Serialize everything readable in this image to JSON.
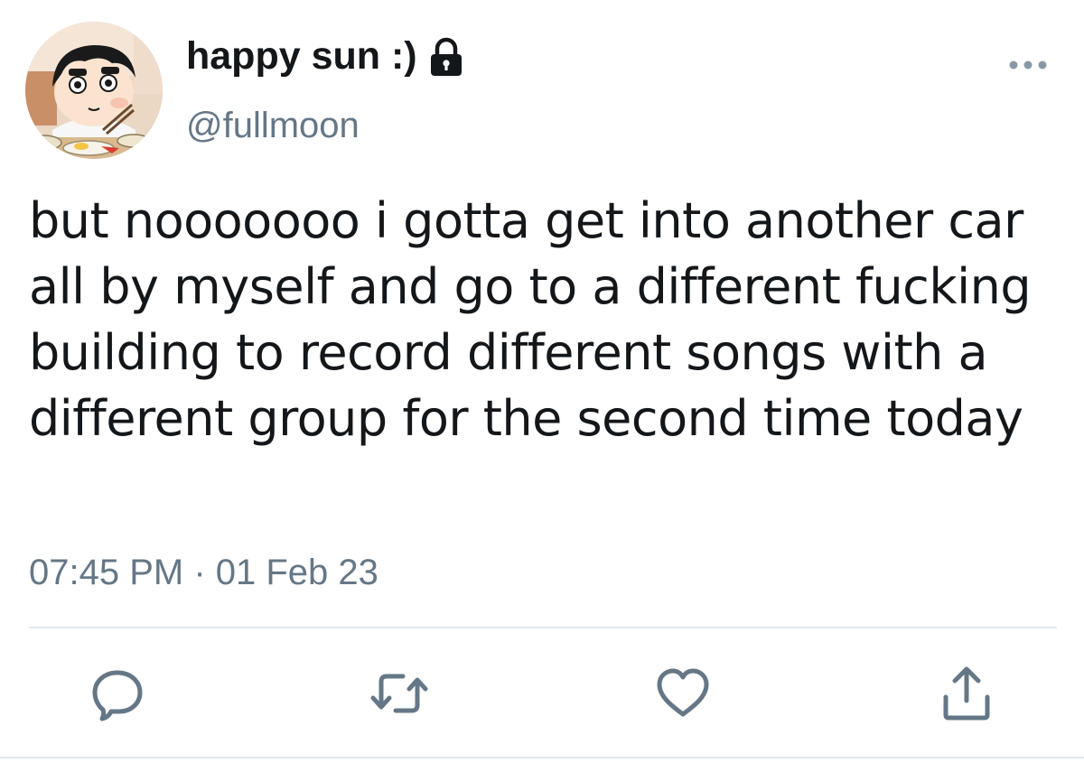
{
  "tweet": {
    "display_name": "happy sun :)",
    "handle": "@fullmoon",
    "text": "but nooooooo i gotta get into another car all by myself and go to a different fucking building to record different songs with a different group for the second time today",
    "timestamp": "07:45 PM · 01 Feb 23",
    "protected": true
  },
  "icons": {
    "lock": "lock-icon",
    "more": "more-icon",
    "reply": "reply-icon",
    "retweet": "retweet-icon",
    "like": "like-icon",
    "share": "share-icon"
  },
  "colors": {
    "text": "#14171a",
    "secondary": "#657786",
    "icon": "#657786",
    "divider": "#e1e8ed"
  }
}
